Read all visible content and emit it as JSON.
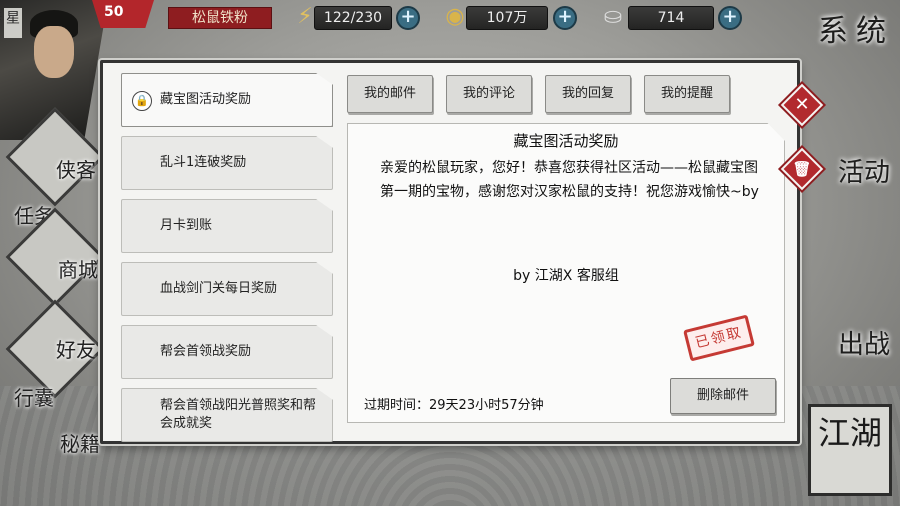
{
  "player": {
    "name": "星梓明",
    "level": "50",
    "title": "松鼠铁粉"
  },
  "resources": {
    "stamina": "122/230",
    "copper": "107万",
    "silver": "714"
  },
  "background": {
    "system_label": "系统",
    "left_menu": [
      "侠客",
      "任务",
      "商城",
      "好友",
      "行囊",
      "秘籍"
    ],
    "right_menu": [
      "活动",
      "出战"
    ],
    "jianghu": "江湖"
  },
  "mail": {
    "list": [
      {
        "title": "藏宝图活动奖励"
      },
      {
        "title": "乱斗1连破奖励"
      },
      {
        "title": "月卡到账"
      },
      {
        "title": "血战剑门关每日奖励"
      },
      {
        "title": "帮会首领战奖励"
      },
      {
        "title": "帮会首领战阳光普照奖和帮会成就奖"
      }
    ],
    "tabs": [
      "我的邮件",
      "我的评论",
      "我的回复",
      "我的提醒"
    ],
    "detail": {
      "title": "藏宝图活动奖励",
      "body": "亲爱的松鼠玩家，您好！恭喜您获得社区活动——松鼠藏宝图第一期的宝物，感谢您对汉家松鼠的支持！祝您游戏愉快~by",
      "signature": "by 江湖X 客服组",
      "stamp": "已领取",
      "expire": "过期时间：29天23小时57分钟",
      "delete_label": "删除邮件"
    },
    "close_symbol": "✕",
    "trash_symbol": "🗑"
  },
  "colors": {
    "accent_red": "#b22a2e",
    "stamp_red": "#c53a34",
    "plus_blue": "#3a6d83"
  }
}
